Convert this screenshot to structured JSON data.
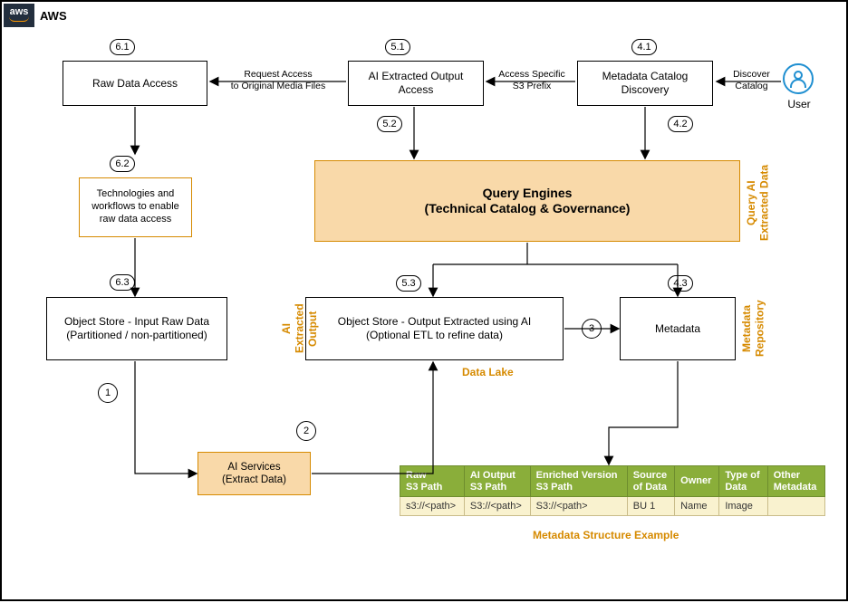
{
  "brand": {
    "logo_text": "aws",
    "label": "AWS"
  },
  "user": {
    "label": "User"
  },
  "boxes": {
    "raw_data_access": "Raw Data Access",
    "ai_extracted_output_access": "AI Extracted Output\nAccess",
    "metadata_catalog_discovery": "Metadata Catalog\nDiscovery",
    "tech_workflows": "Technologies and\nworkflows to enable\nraw data access",
    "query_engines": "Query Engines\n(Technical Catalog & Governance)",
    "obj_store_input": "Object Store - Input Raw Data\n(Partitioned / non-partitioned)",
    "obj_store_output": "Object Store - Output Extracted using AI\n(Optional ETL to refine data)",
    "metadata_box": "Metadata",
    "ai_services": "AI Services\n(Extract Data)"
  },
  "steps": {
    "s6_1": "6.1",
    "s5_1": "5.1",
    "s4_1": "4.1",
    "s6_2": "6.2",
    "s5_2": "5.2",
    "s4_2": "4.2",
    "s6_3": "6.3",
    "s5_3": "5.3",
    "s4_3": "4.3",
    "s1": "1",
    "s2": "2",
    "s3": "3"
  },
  "edges": {
    "request_access": "Request Access\nto Original Media Files",
    "access_prefix": "Access Specific\nS3 Prefix",
    "discover_catalog": "Discover\nCatalog"
  },
  "side_labels": {
    "query_ai": "Query AI\nExtracted Data",
    "ai_extracted_output": "AI Extracted\nOutput",
    "metadata_repo": "Metadata\nRepository",
    "data_lake": "Data Lake"
  },
  "captions": {
    "metadata_example": "Metadata Structure Example"
  },
  "table": {
    "headers": [
      "Raw\nS3 Path",
      "AI Output\nS3 Path",
      "Enriched Version\nS3 Path",
      "Source\nof Data",
      "Owner",
      "Type of\nData",
      "Other\nMetadata"
    ],
    "rows": [
      [
        "s3://<path>",
        "S3://<path>",
        "S3://<path>",
        "BU 1",
        "Name",
        "Image",
        ""
      ]
    ]
  }
}
